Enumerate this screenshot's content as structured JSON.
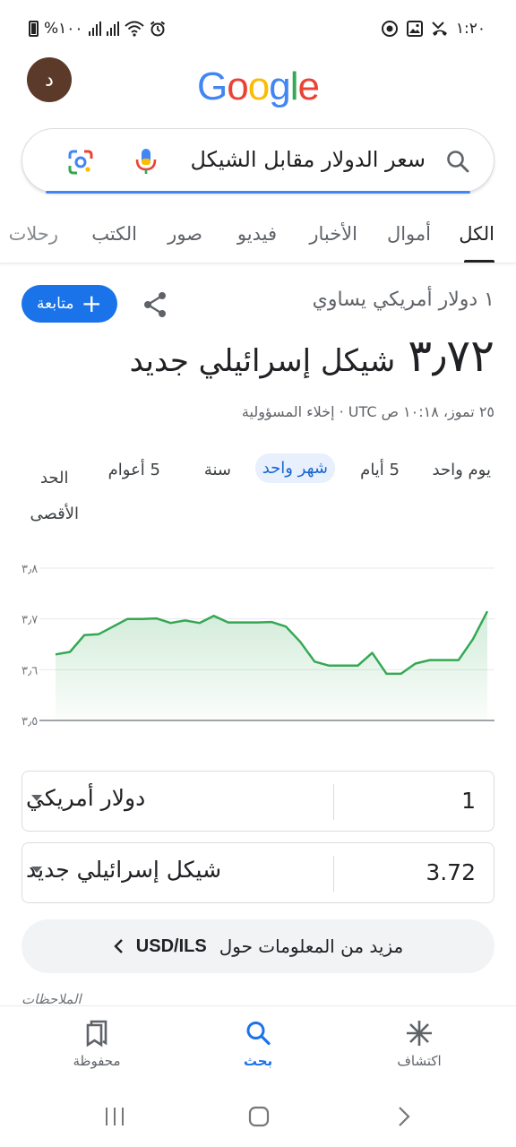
{
  "status_bar": {
    "battery_text": "%١٠٠",
    "time": "١:٢٠"
  },
  "header": {
    "avatar_letter": "د",
    "logo_letters": [
      "G",
      "o",
      "o",
      "g",
      "l",
      "e"
    ],
    "logo_colors": [
      "#4285f4",
      "#ea4335",
      "#fbbc05",
      "#4285f4",
      "#34a853",
      "#ea4335"
    ]
  },
  "search": {
    "query": "سعر الدولار مقابل الشيكل"
  },
  "tabs": [
    {
      "label": "الكل",
      "active": true
    },
    {
      "label": "أموال",
      "active": false
    },
    {
      "label": "الأخبار",
      "active": false
    },
    {
      "label": "فيديو",
      "active": false
    },
    {
      "label": "صور",
      "active": false
    },
    {
      "label": "الكتب",
      "active": false
    },
    {
      "label": "رحلات",
      "active": false
    }
  ],
  "currency": {
    "line1": "١ دولار أمريكي يساوي",
    "follow_label": "متابعة",
    "rate_value": "٣٫٧٢",
    "rate_unit": "شيكل إسرائيلي جديد",
    "timestamp": "٢٥ تموز، ١٠:١٨ ص UTC · إخلاء المسؤولية"
  },
  "ranges": [
    {
      "label": "يوم واحد",
      "active": false
    },
    {
      "label": "5 أيام",
      "active": false
    },
    {
      "label": "شهر واحد",
      "active": true
    },
    {
      "label": "سنة",
      "active": false
    },
    {
      "label": "5 أعوام",
      "active": false
    },
    {
      "label": "الحد\nالأقصى",
      "active": false
    }
  ],
  "chart_data": {
    "type": "area",
    "y_tick_labels": [
      "٣٫٨",
      "٣٫٧",
      "٣٫٦",
      "٣٫٥"
    ],
    "y_ticks": [
      3.8,
      3.7,
      3.6,
      3.5
    ],
    "ylim": [
      3.5,
      3.8
    ],
    "values": [
      3.63,
      3.635,
      3.668,
      3.67,
      3.685,
      3.7,
      3.7,
      3.701,
      3.692,
      3.697,
      3.692,
      3.706,
      3.693,
      3.693,
      3.693,
      3.694,
      3.685,
      3.655,
      3.616,
      3.608,
      3.608,
      3.608,
      3.633,
      3.592,
      3.592,
      3.612,
      3.619,
      3.619,
      3.619,
      3.66,
      3.715
    ],
    "line_color": "#34a853",
    "grid": true
  },
  "converter": {
    "from_amount": "1",
    "from_unit": "دولار أمريكي",
    "to_amount": "3.72",
    "to_unit": "شيكل إسرائيلي جديد"
  },
  "more_info": {
    "label": "مزيد من المعلومات حول",
    "pair": "USD/ILS"
  },
  "notes_label": "الملاحظات",
  "bottom_nav": [
    {
      "label": "محفوظة",
      "icon": "bookmarks-icon",
      "active": false
    },
    {
      "label": "بحث",
      "icon": "search-icon",
      "active": true
    },
    {
      "label": "اكتشاف",
      "icon": "discover-asterisk-icon",
      "active": false
    }
  ]
}
